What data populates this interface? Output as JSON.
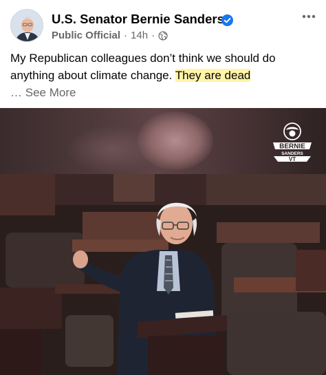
{
  "post": {
    "author": "U.S. Senator Bernie Sanders",
    "role": "Public Official",
    "separator": "·",
    "time": "14h",
    "text_main": "My Republican colleagues don’t think we should do anything about climate change. ",
    "text_highlight": "They are dead",
    "ellipsis": "…",
    "see_more": "See More"
  },
  "icons": {
    "verified": "verified-badge-icon",
    "audience": "globe-icon",
    "more": "more-options-icon"
  },
  "video": {
    "logo_line1": "BERNIE",
    "logo_line2": "SANDERS",
    "logo_line3": "VT"
  },
  "colors": {
    "verified_blue": "#1877f2",
    "highlight": "#fff4a8",
    "secondary_text": "#65676b"
  }
}
